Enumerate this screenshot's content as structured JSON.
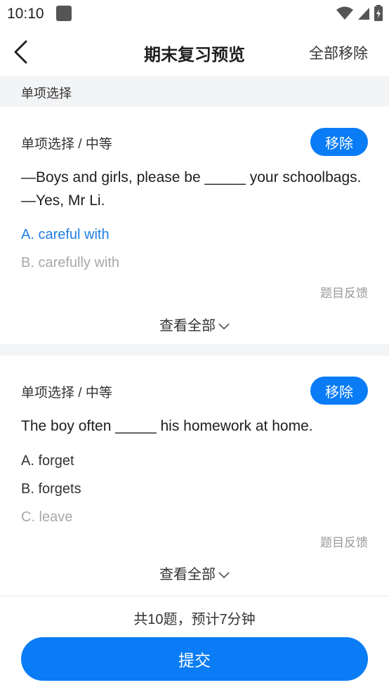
{
  "status_bar": {
    "time": "10:10"
  },
  "nav": {
    "title": "期末复习预览",
    "remove_all": "全部移除"
  },
  "section": {
    "title": "单项选择"
  },
  "questions": [
    {
      "meta": "单项选择 / 中等",
      "remove_label": "移除",
      "stem_lines": [
        "—Boys and girls, please be _____ your schoolbags.",
        "—Yes, Mr Li."
      ],
      "options": [
        {
          "text": "A. careful with",
          "state": "selected"
        },
        {
          "text": "B. carefully with",
          "state": "faded"
        }
      ],
      "feedback": "题目反馈",
      "view_all": "查看全部"
    },
    {
      "meta": "单项选择 / 中等",
      "remove_label": "移除",
      "stem_lines": [
        "The boy often _____ his homework at home."
      ],
      "options": [
        {
          "text": "A. forget",
          "state": "normal"
        },
        {
          "text": "B. forgets",
          "state": "normal"
        },
        {
          "text": "C. leave",
          "state": "faded"
        }
      ],
      "feedback": "题目反馈",
      "view_all": "查看全部"
    }
  ],
  "footer": {
    "summary": "共10题，预计7分钟",
    "submit_label": "提交"
  },
  "colors": {
    "accent": "#0a7cf5",
    "selected_option": "#1f7fe5",
    "faded_option": "#a8a8a8"
  },
  "icons": [
    "back-arrow-icon",
    "chevron-down-icon",
    "wifi-icon",
    "signal-icon",
    "battery-charging-icon",
    "app-notification-icon"
  ]
}
